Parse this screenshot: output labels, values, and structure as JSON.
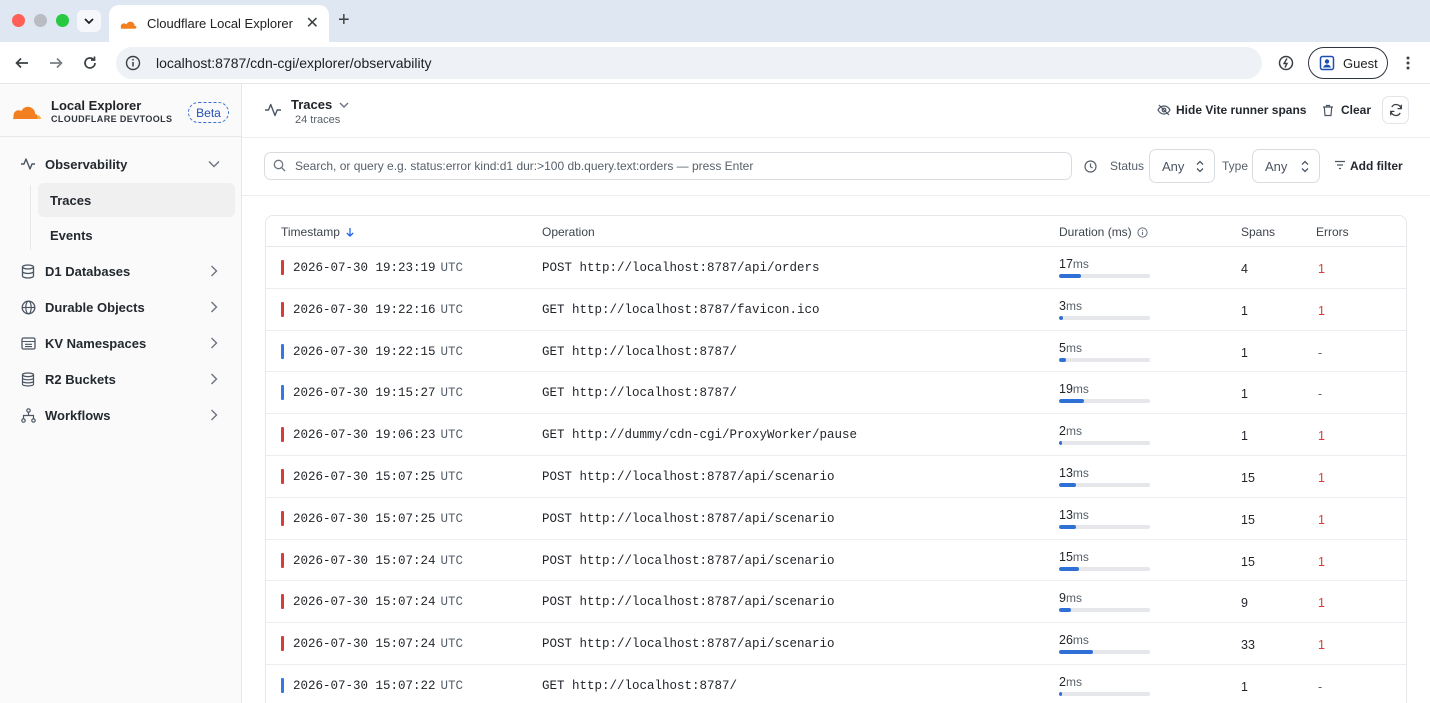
{
  "browser": {
    "tab_title": "Cloudflare Local Explorer",
    "url": "localhost:8787/cdn-cgi/explorer/observability",
    "profile_label": "Guest"
  },
  "colors": {
    "accent_blue": "#2f6fd6",
    "error_red": "#d93a3a",
    "ok_blue": "#3578e5",
    "cloudflare_orange": "#f38020"
  },
  "sidebar": {
    "brand_title": "Local Explorer",
    "brand_subtitle": "CLOUDFLARE DEVTOOLS",
    "badge": "Beta",
    "observability": {
      "label": "Observability",
      "icon": "activity-icon"
    },
    "sub_items": [
      {
        "label": "Traces",
        "active": true
      },
      {
        "label": "Events",
        "active": false
      }
    ],
    "items": [
      {
        "label": "D1 Databases",
        "icon": "database-icon"
      },
      {
        "label": "Durable Objects",
        "icon": "globe-icon"
      },
      {
        "label": "KV Namespaces",
        "icon": "list-icon"
      },
      {
        "label": "R2 Buckets",
        "icon": "cylinder-icon"
      },
      {
        "label": "Workflows",
        "icon": "workflow-icon"
      }
    ]
  },
  "header": {
    "title": "Traces",
    "count": "24 traces",
    "hide_spans_label": "Hide Vite runner spans",
    "clear_label": "Clear"
  },
  "filters": {
    "search_placeholder": "Search, or query e.g. status:error kind:d1 dur:>100 db.query.text:orders — press Enter",
    "status_label": "Status",
    "status_value": "Any",
    "type_label": "Type",
    "type_value": "Any",
    "add_filter_label": "Add filter"
  },
  "table": {
    "columns": {
      "timestamp": "Timestamp",
      "operation": "Operation",
      "duration": "Duration (ms)",
      "spans": "Spans",
      "errors": "Errors"
    },
    "max_duration_scale": 70,
    "rows": [
      {
        "date": "2026-07-30 19:23:19",
        "tz": "UTC",
        "operation": "POST http://localhost:8787/api/orders",
        "duration": 17,
        "unit": "ms",
        "spans": "4",
        "errors": "1",
        "status": "error"
      },
      {
        "date": "2026-07-30 19:22:16",
        "tz": "UTC",
        "operation": "GET http://localhost:8787/favicon.ico",
        "duration": 3,
        "unit": "ms",
        "spans": "1",
        "errors": "1",
        "status": "error"
      },
      {
        "date": "2026-07-30 19:22:15",
        "tz": "UTC",
        "operation": "GET http://localhost:8787/",
        "duration": 5,
        "unit": "ms",
        "spans": "1",
        "errors": "-",
        "status": "ok"
      },
      {
        "date": "2026-07-30 19:15:27",
        "tz": "UTC",
        "operation": "GET http://localhost:8787/",
        "duration": 19,
        "unit": "ms",
        "spans": "1",
        "errors": "-",
        "status": "ok"
      },
      {
        "date": "2026-07-30 19:06:23",
        "tz": "UTC",
        "operation": "GET http://dummy/cdn-cgi/ProxyWorker/pause",
        "duration": 2,
        "unit": "ms",
        "spans": "1",
        "errors": "1",
        "status": "error"
      },
      {
        "date": "2026-07-30 15:07:25",
        "tz": "UTC",
        "operation": "POST http://localhost:8787/api/scenario",
        "duration": 13,
        "unit": "ms",
        "spans": "15",
        "errors": "1",
        "status": "error"
      },
      {
        "date": "2026-07-30 15:07:25",
        "tz": "UTC",
        "operation": "POST http://localhost:8787/api/scenario",
        "duration": 13,
        "unit": "ms",
        "spans": "15",
        "errors": "1",
        "status": "error"
      },
      {
        "date": "2026-07-30 15:07:24",
        "tz": "UTC",
        "operation": "POST http://localhost:8787/api/scenario",
        "duration": 15,
        "unit": "ms",
        "spans": "15",
        "errors": "1",
        "status": "error"
      },
      {
        "date": "2026-07-30 15:07:24",
        "tz": "UTC",
        "operation": "POST http://localhost:8787/api/scenario",
        "duration": 9,
        "unit": "ms",
        "spans": "9",
        "errors": "1",
        "status": "error"
      },
      {
        "date": "2026-07-30 15:07:24",
        "tz": "UTC",
        "operation": "POST http://localhost:8787/api/scenario",
        "duration": 26,
        "unit": "ms",
        "spans": "33",
        "errors": "1",
        "status": "error"
      },
      {
        "date": "2026-07-30 15:07:22",
        "tz": "UTC",
        "operation": "GET http://localhost:8787/",
        "duration": 2,
        "unit": "ms",
        "spans": "1",
        "errors": "-",
        "status": "ok"
      }
    ]
  }
}
